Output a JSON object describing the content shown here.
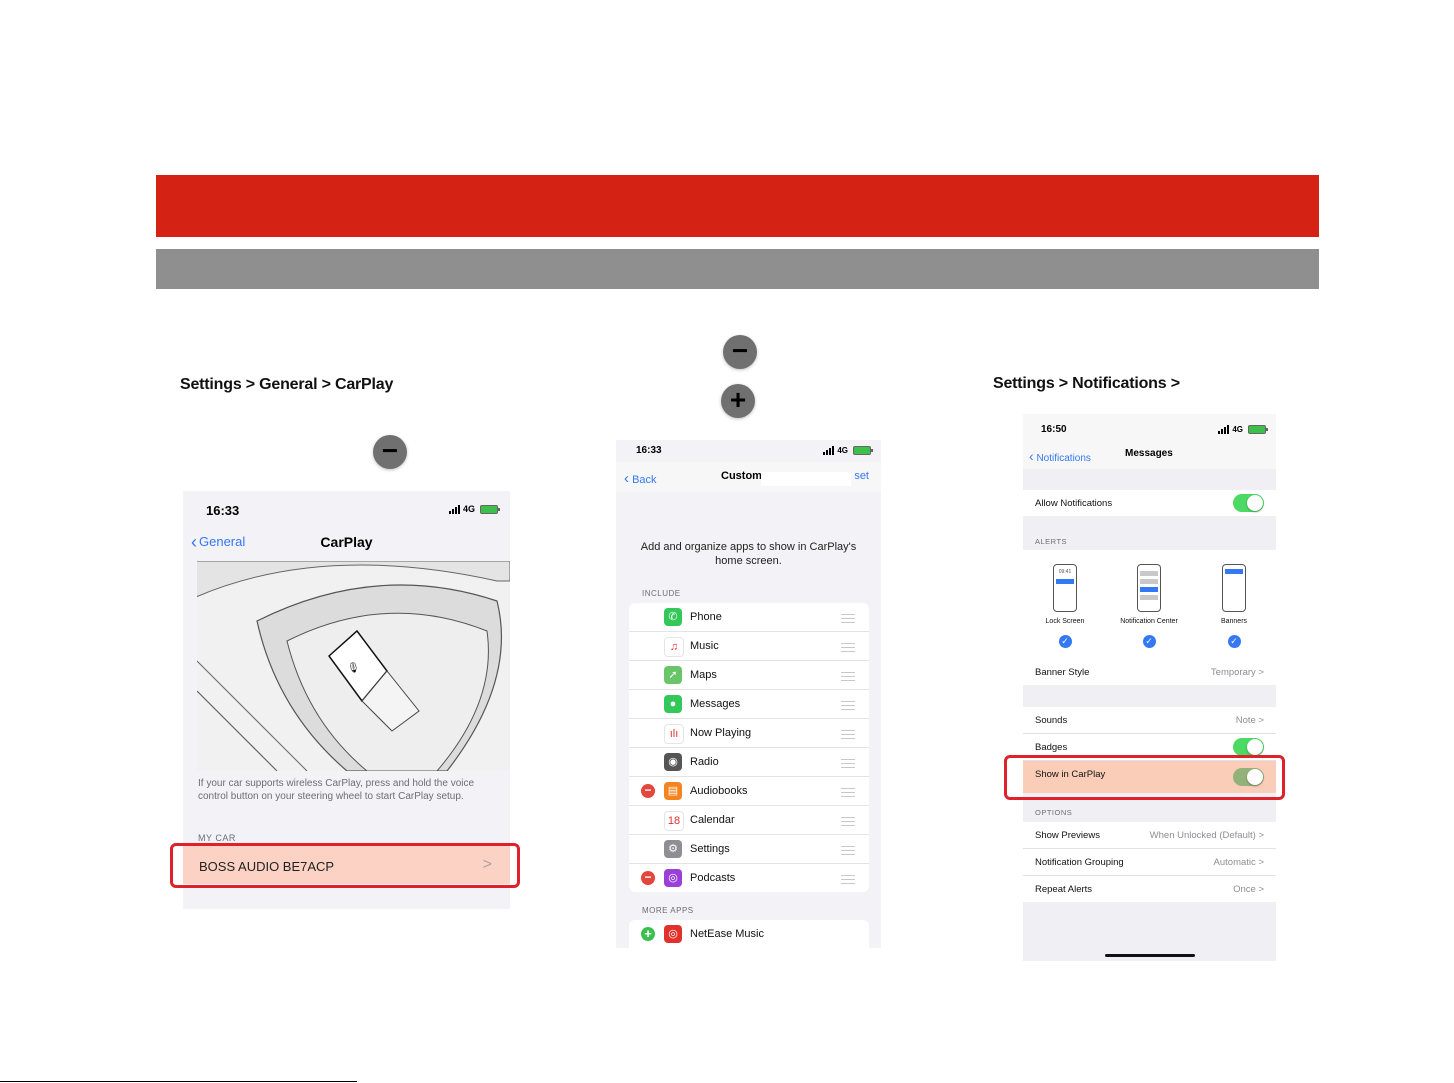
{
  "steps": {
    "step1": {
      "title": "Settings > General > CarPlay"
    },
    "step3": {
      "title": "Settings > Notifications >"
    }
  },
  "buttons": {
    "minus_symbol": "−",
    "plus_symbol": "+"
  },
  "phone1": {
    "time": "16:33",
    "network": "4G",
    "back_label": "General",
    "title": "CarPlay",
    "description": "If your car supports wireless CarPlay, press and hold the voice control button on your steering wheel to start CarPlay setup.",
    "section_label": "MY CAR",
    "car_name": "BOSS AUDIO BE7ACP",
    "chevron": ">"
  },
  "phone2": {
    "time": "16:33",
    "network": "4G",
    "back_label": "Back",
    "title": "Custom",
    "reset_label": "set",
    "intro": "Add and organize apps to show in CarPlay's home screen.",
    "include_label": "INCLUDE",
    "apps": [
      {
        "name": "Phone",
        "icon": "phone-icon",
        "color": "#34c759",
        "glyph": "✆",
        "removable": false
      },
      {
        "name": "Music",
        "icon": "music-icon",
        "color": "#ffffff",
        "glyph": "♫",
        "removable": false
      },
      {
        "name": "Maps",
        "icon": "maps-icon",
        "color": "#6ac46a",
        "glyph": "➚",
        "removable": false
      },
      {
        "name": "Messages",
        "icon": "messages-icon",
        "color": "#34c759",
        "glyph": "●",
        "removable": false
      },
      {
        "name": "Now Playing",
        "icon": "now-playing-icon",
        "color": "#ffffff",
        "glyph": "ılı",
        "removable": false
      },
      {
        "name": "Radio",
        "icon": "radio-icon",
        "color": "#555555",
        "glyph": "◉",
        "removable": false
      },
      {
        "name": "Audiobooks",
        "icon": "audiobooks-icon",
        "color": "#f5831f",
        "glyph": "▤",
        "removable": true
      },
      {
        "name": "Calendar",
        "icon": "calendar-icon",
        "color": "#ffffff",
        "glyph": "18",
        "removable": false
      },
      {
        "name": "Settings",
        "icon": "settings-icon",
        "color": "#8e8e93",
        "glyph": "⚙",
        "removable": false
      },
      {
        "name": "Podcasts",
        "icon": "podcasts-icon",
        "color": "#9b3fd9",
        "glyph": "◎",
        "removable": true
      }
    ],
    "more_label": "MORE APPS",
    "more_apps": [
      {
        "name": "NetEase Music",
        "icon": "netease-music-icon",
        "color": "#e0312c",
        "glyph": "◎"
      }
    ]
  },
  "phone3": {
    "time": "16:50",
    "network": "4G",
    "back_label": "Notifications",
    "title": "Messages",
    "allow_label": "Allow Notifications",
    "alerts_label": "ALERTS",
    "alert_styles": [
      {
        "name": "Lock Screen",
        "mini_time": "09:41"
      },
      {
        "name": "Notification Center"
      },
      {
        "name": "Banners"
      }
    ],
    "banner_style_label": "Banner Style",
    "banner_style_value": "Temporary",
    "sounds_label": "Sounds",
    "sounds_value": "Note",
    "badges_label": "Badges",
    "show_carplay_label": "Show in CarPlay",
    "options_label": "OPTIONS",
    "options": [
      {
        "label": "Show Previews",
        "value": "When Unlocked (Default)"
      },
      {
        "label": "Notification Grouping",
        "value": "Automatic"
      },
      {
        "label": "Repeat Alerts",
        "value": "Once"
      }
    ],
    "chevron": ">"
  },
  "colors": {
    "red_banner": "#d42214",
    "gray_banner": "#908f90",
    "highlight_border": "#e0202a",
    "ios_blue": "#3478f6",
    "toggle_green": "#4cd964"
  }
}
